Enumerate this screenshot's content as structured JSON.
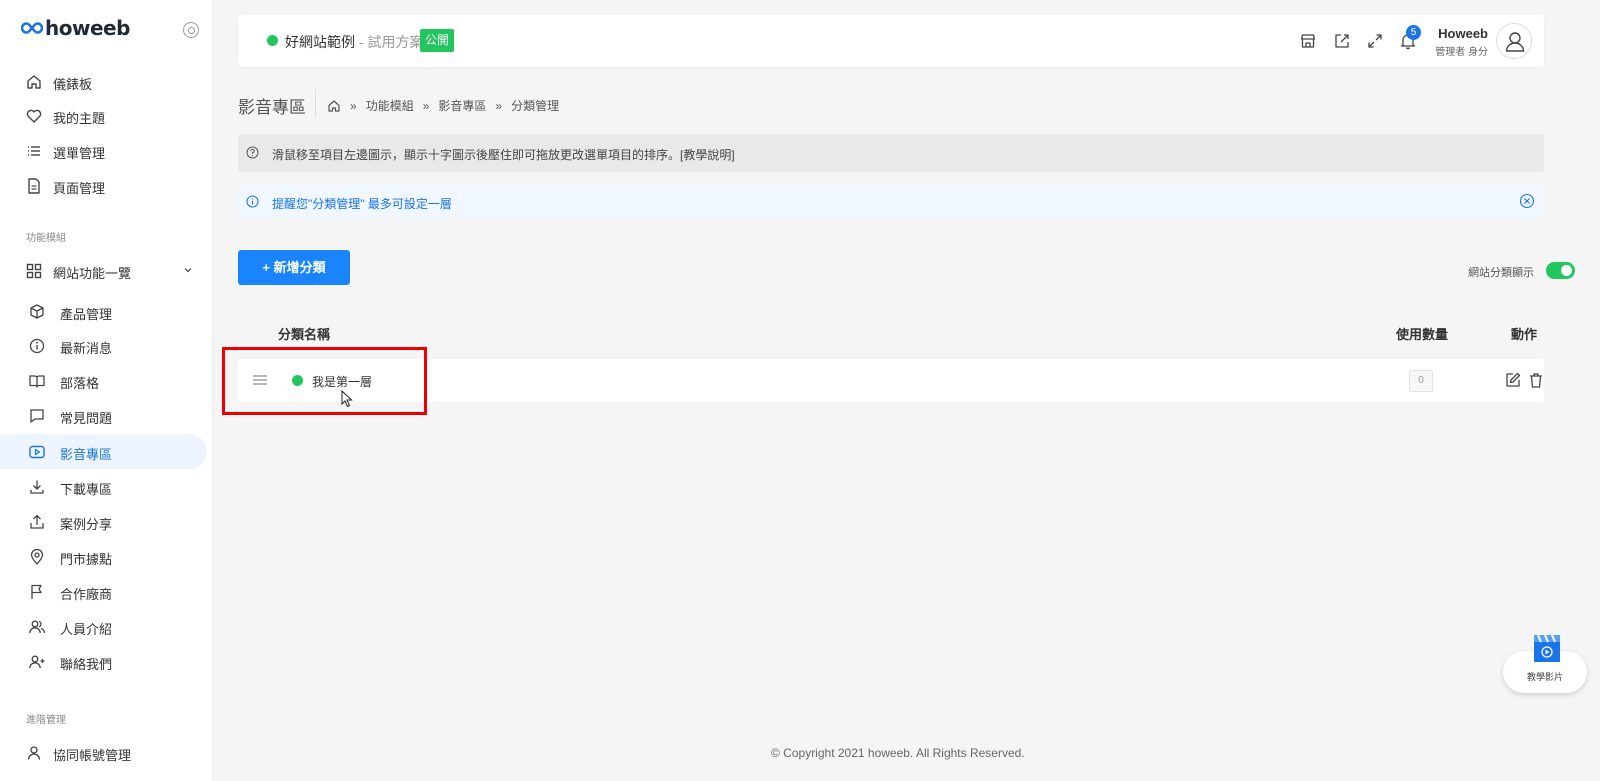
{
  "brand": {
    "logo_text": "howeeb"
  },
  "sidebar": {
    "top_items": [
      {
        "label": "儀錶板",
        "icon": "home-icon"
      },
      {
        "label": "我的主題",
        "icon": "heart-icon"
      },
      {
        "label": "選單管理",
        "icon": "list-icon"
      },
      {
        "label": "頁面管理",
        "icon": "document-icon"
      }
    ],
    "section_modules": "功能模組",
    "modules_group": {
      "label": "網站功能一覽",
      "icon": "grid-icon"
    },
    "sub_items": [
      {
        "label": "產品管理",
        "icon": "box-icon"
      },
      {
        "label": "最新消息",
        "icon": "info-icon"
      },
      {
        "label": "部落格",
        "icon": "book-icon"
      },
      {
        "label": "常見問題",
        "icon": "chat-icon"
      },
      {
        "label": "影音專區",
        "icon": "video-icon",
        "active": true
      },
      {
        "label": "下載專區",
        "icon": "download-icon"
      },
      {
        "label": "案例分享",
        "icon": "share-icon"
      },
      {
        "label": "門市據點",
        "icon": "pin-icon"
      },
      {
        "label": "合作廠商",
        "icon": "flag-icon"
      },
      {
        "label": "人員介紹",
        "icon": "users-icon"
      },
      {
        "label": "聯絡我們",
        "icon": "user-plus-icon"
      }
    ],
    "section_advanced": "進階管理",
    "bottom_items": [
      {
        "label": "協同帳號管理",
        "icon": "user-icon"
      }
    ]
  },
  "header": {
    "site_name": "好網站範例",
    "site_plan": " - 試用方案",
    "public_badge": "公開",
    "notifications": "5",
    "user_name": "Howeeb",
    "user_role": "管理者 身分"
  },
  "breadcrumb": {
    "page_title": "影音專區",
    "items": [
      "功能模組",
      "影音專區",
      "分類管理"
    ]
  },
  "alerts": {
    "tip": "滑鼠移至項目左邊圖示，顯示十字圖示後壓住即可拖放更改選單項目的排序。[教學說明]",
    "reminder": "提醒您\"分類管理\" 最多可設定一層"
  },
  "toolbar": {
    "add_label": "+ 新增分類",
    "toggle_label": "網站分類顯示",
    "toggle_on": true
  },
  "table": {
    "headers": {
      "name": "分類名稱",
      "count": "使用數量",
      "action": "動作"
    },
    "rows": [
      {
        "name": "我是第一層",
        "count": "0"
      }
    ]
  },
  "footer": {
    "copyright": "© Copyright 2021 howeeb. All Rights Reserved."
  },
  "tutorial": {
    "label": "教學影片"
  },
  "colors": {
    "accent": "#1a84ff",
    "success": "#22c55e",
    "highlight": "#e00000"
  }
}
